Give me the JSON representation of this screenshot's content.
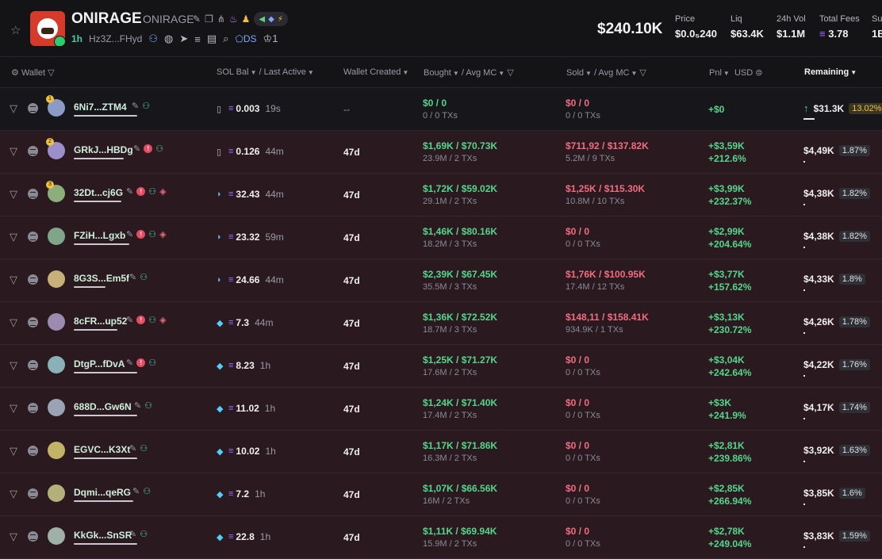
{
  "token": {
    "name": "ONIRAGE",
    "symbol": "ONIRAGE",
    "age": "1h",
    "address": "Hz3Z...FHyd",
    "ds_label": "DS",
    "holders_count": "1",
    "market_cap": "$240.10K",
    "stats": [
      {
        "label": "Price",
        "value": "$0.0₅240"
      },
      {
        "label": "Liq",
        "value": "$63.4K"
      },
      {
        "label": "24h Vol",
        "value": "$1.1M"
      },
      {
        "label": "Total Fees",
        "value": "3.78"
      },
      {
        "label": "Su",
        "value": "1B"
      }
    ]
  },
  "columns": {
    "wallet": "Wallet",
    "sol_bal": "SOL Bal",
    "last_active": "Last Active",
    "wallet_created": "Wallet Created",
    "bought": "Bought",
    "avg_mc_buy": "Avg MC",
    "sold": "Sold",
    "avg_mc_sell": "Avg MC",
    "pnl": "Pnl",
    "usd": "USD",
    "remaining": "Remaining"
  },
  "rows": [
    {
      "wallet": "6Ni7...ZTM4",
      "rank": "1",
      "sol": "0.003",
      "active": "19s",
      "created": "--",
      "bought": "$0 / 0",
      "bought_sub": "0 / 0 TXs",
      "sold": "$0 / 0",
      "sold_sub": "0 / 0 TXs",
      "pnl": "+$0",
      "pnl_pct": "",
      "remaining": "$31.3K",
      "remaining_pct": "13.02%"
    },
    {
      "wallet": "GRkJ...HBDg",
      "rank": "2",
      "sol": "0.126",
      "active": "44m",
      "created": "47d",
      "bought": "$1,69K / $70.73K",
      "bought_sub": "23.9M / 2 TXs",
      "sold": "$711,92 / $137.82K",
      "sold_sub": "5.2M / 9 TXs",
      "pnl": "+$3,59K",
      "pnl_pct": "+212.6%",
      "remaining": "$4,49K",
      "remaining_pct": "1.87%"
    },
    {
      "wallet": "32Dt...cj6G",
      "rank": "3",
      "sol": "32.43",
      "active": "44m",
      "created": "47d",
      "bought": "$1,72K / $59.02K",
      "bought_sub": "29.1M / 2 TXs",
      "sold": "$1,25K / $115.30K",
      "sold_sub": "10.8M / 10 TXs",
      "pnl": "+$3,99K",
      "pnl_pct": "+232.37%",
      "remaining": "$4,38K",
      "remaining_pct": "1.82%"
    },
    {
      "wallet": "FZiH...Lgxb",
      "rank": "",
      "sol": "23.32",
      "active": "59m",
      "created": "47d",
      "bought": "$1,46K / $80.16K",
      "bought_sub": "18.2M / 3 TXs",
      "sold": "$0 / 0",
      "sold_sub": "0 / 0 TXs",
      "pnl": "+$2,99K",
      "pnl_pct": "+204.64%",
      "remaining": "$4,38K",
      "remaining_pct": "1.82%"
    },
    {
      "wallet": "8G3S...Em5f",
      "rank": "",
      "sol": "24.66",
      "active": "44m",
      "created": "47d",
      "bought": "$2,39K / $67.45K",
      "bought_sub": "35.5M / 3 TXs",
      "sold": "$1,76K / $100.95K",
      "sold_sub": "17.4M / 12 TXs",
      "pnl": "+$3,77K",
      "pnl_pct": "+157.62%",
      "remaining": "$4,33K",
      "remaining_pct": "1.8%"
    },
    {
      "wallet": "8cFR...up52",
      "rank": "",
      "sol": "7.3",
      "active": "44m",
      "created": "47d",
      "bought": "$1,36K / $72.52K",
      "bought_sub": "18.7M / 3 TXs",
      "sold": "$148,11 / $158.41K",
      "sold_sub": "934.9K / 1 TXs",
      "pnl": "+$3,13K",
      "pnl_pct": "+230.72%",
      "remaining": "$4,26K",
      "remaining_pct": "1.78%"
    },
    {
      "wallet": "DtgP...fDvA",
      "rank": "",
      "sol": "8.23",
      "active": "1h",
      "created": "47d",
      "bought": "$1,25K / $71.27K",
      "bought_sub": "17.6M / 2 TXs",
      "sold": "$0 / 0",
      "sold_sub": "0 / 0 TXs",
      "pnl": "+$3,04K",
      "pnl_pct": "+242.64%",
      "remaining": "$4,22K",
      "remaining_pct": "1.76%"
    },
    {
      "wallet": "688D...Gw6N",
      "rank": "",
      "sol": "11.02",
      "active": "1h",
      "created": "47d",
      "bought": "$1,24K / $71.40K",
      "bought_sub": "17.4M / 2 TXs",
      "sold": "$0 / 0",
      "sold_sub": "0 / 0 TXs",
      "pnl": "+$3K",
      "pnl_pct": "+241.9%",
      "remaining": "$4,17K",
      "remaining_pct": "1.74%"
    },
    {
      "wallet": "EGVC...K3Xt",
      "rank": "",
      "sol": "10.02",
      "active": "1h",
      "created": "47d",
      "bought": "$1,17K / $71.86K",
      "bought_sub": "16.3M / 2 TXs",
      "sold": "$0 / 0",
      "sold_sub": "0 / 0 TXs",
      "pnl": "+$2,81K",
      "pnl_pct": "+239.86%",
      "remaining": "$3,92K",
      "remaining_pct": "1.63%"
    },
    {
      "wallet": "Dqmi...qeRG",
      "rank": "",
      "sol": "7.2",
      "active": "1h",
      "created": "47d",
      "bought": "$1,07K / $66.56K",
      "bought_sub": "16M / 2 TXs",
      "sold": "$0 / 0",
      "sold_sub": "0 / 0 TXs",
      "pnl": "+$2,85K",
      "pnl_pct": "+266.94%",
      "remaining": "$3,85K",
      "remaining_pct": "1.6%"
    },
    {
      "wallet": "KkGk...SnSR",
      "rank": "",
      "sol": "22.8",
      "active": "1h",
      "created": "47d",
      "bought": "$1,11K / $69.94K",
      "bought_sub": "15.9M / 2 TXs",
      "sold": "$0 / 0",
      "sold_sub": "0 / 0 TXs",
      "pnl": "+$2,78K",
      "pnl_pct": "+249.04%",
      "remaining": "$3,83K",
      "remaining_pct": "1.59%"
    }
  ]
}
